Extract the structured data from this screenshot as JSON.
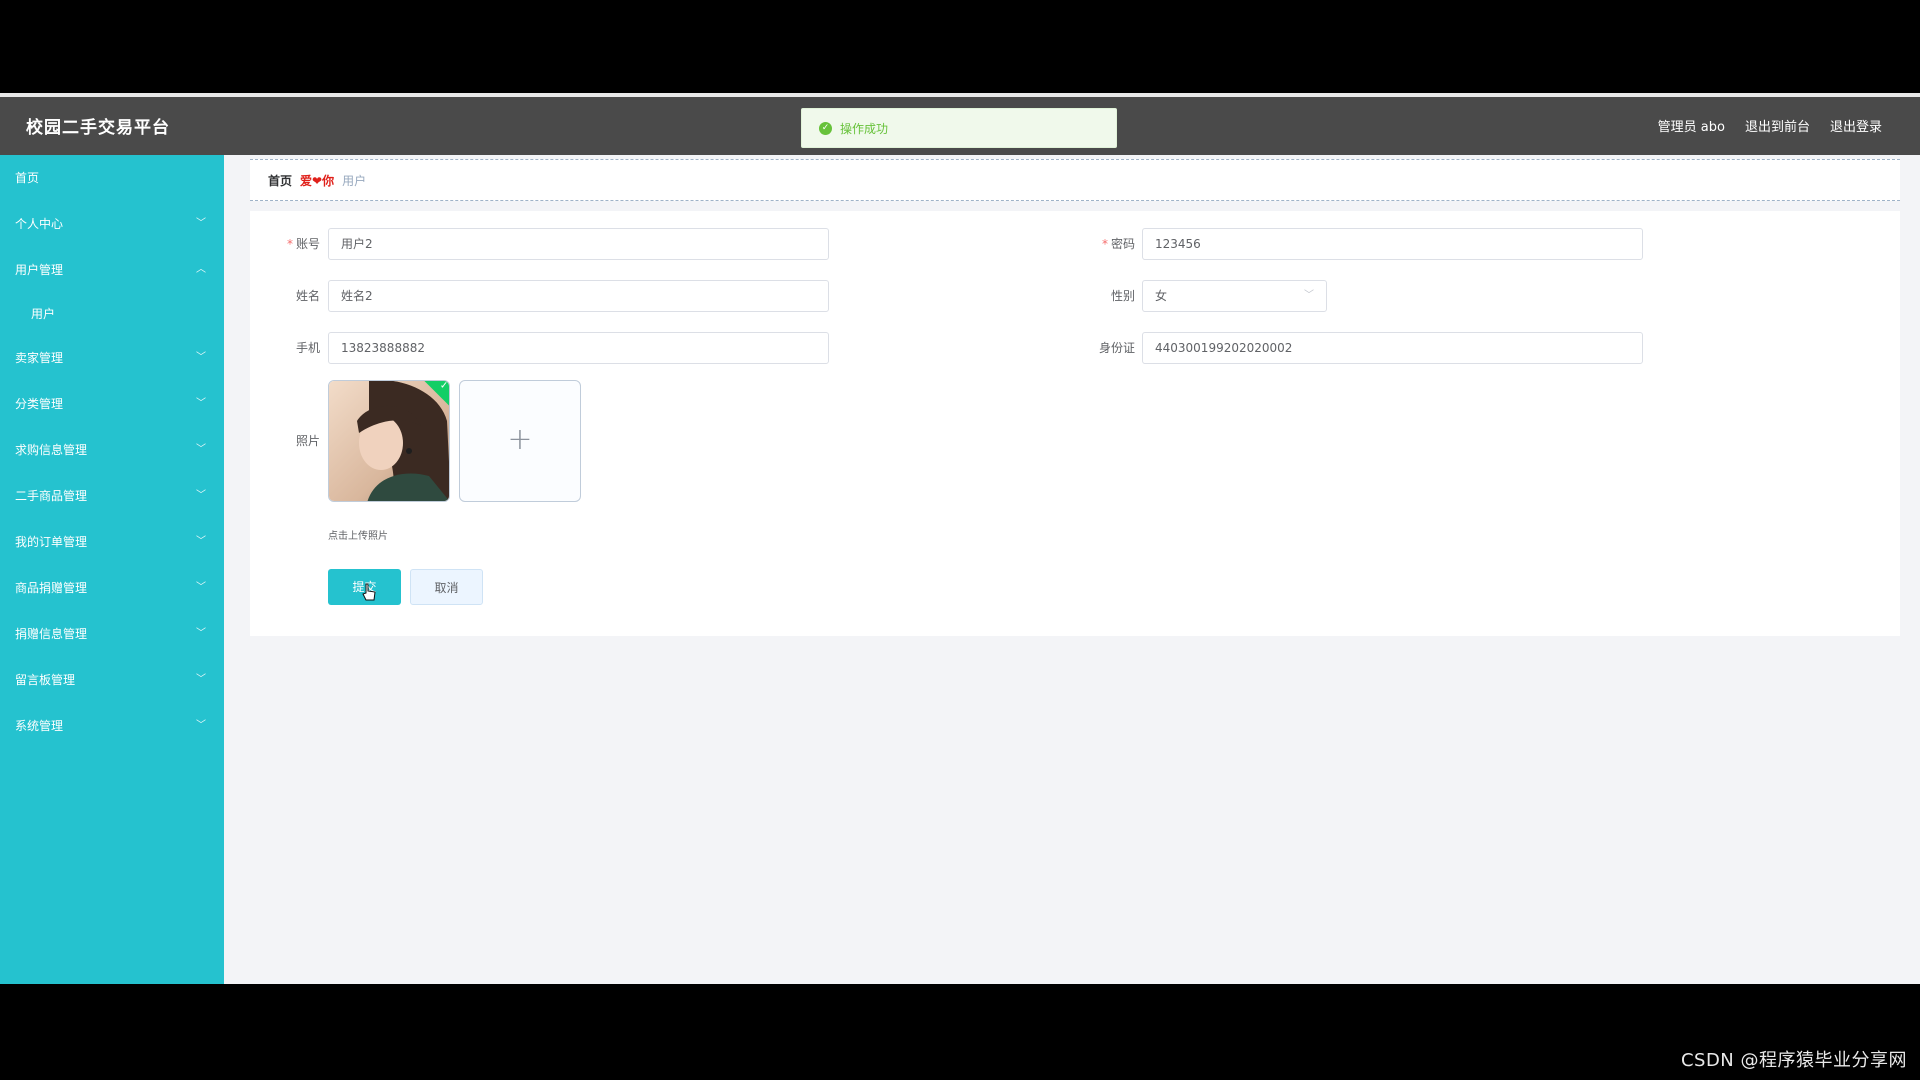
{
  "header": {
    "title": "校园二手交易平台",
    "admin_label": "管理员 abo",
    "front_link": "退出到前台",
    "logout_link": "退出登录"
  },
  "toast": {
    "message": "操作成功",
    "color": "#67c23a"
  },
  "sidebar": {
    "accent": "#25c2cf",
    "items": [
      {
        "label": "首页"
      },
      {
        "label": "个人中心"
      },
      {
        "label": "用户管理"
      },
      {
        "label": "用户"
      },
      {
        "label": "卖家管理"
      },
      {
        "label": "分类管理"
      },
      {
        "label": "求购信息管理"
      },
      {
        "label": "二手商品管理"
      },
      {
        "label": "我的订单管理"
      },
      {
        "label": "商品捐赠管理"
      },
      {
        "label": "捐赠信息管理"
      },
      {
        "label": "留言板管理"
      },
      {
        "label": "系统管理"
      }
    ]
  },
  "breadcrumb": {
    "home": "首页",
    "separator": "爱❤你",
    "current": "用户"
  },
  "form": {
    "account_label": "账号",
    "account_value": "用户2",
    "password_label": "密码",
    "password_value": "123456",
    "name_label": "姓名",
    "name_value": "姓名2",
    "gender_label": "性别",
    "gender_value": "女",
    "phone_label": "手机",
    "phone_value": "13823888882",
    "idcard_label": "身份证",
    "idcard_value": "440300199202020002",
    "photo_label": "照片",
    "upload_hint": "点击上传照片",
    "submit_label": "提交",
    "cancel_label": "取消"
  },
  "watermark": "CSDN @程序猿毕业分享网"
}
